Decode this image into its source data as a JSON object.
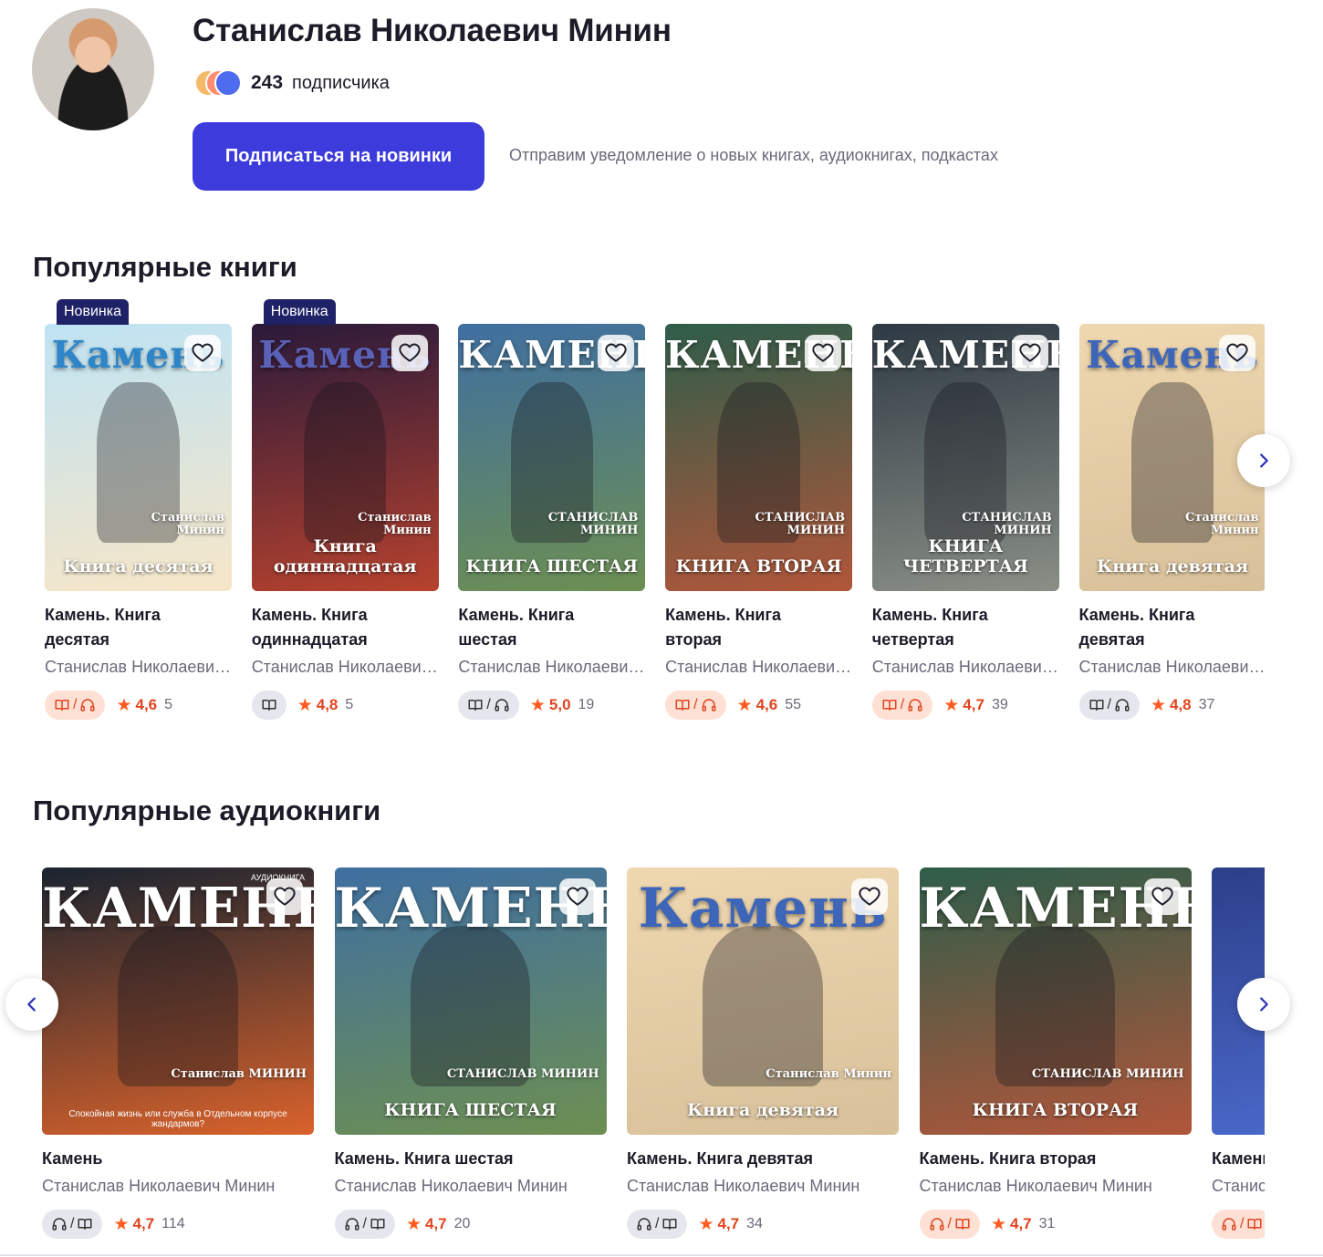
{
  "author": {
    "name": "Станислав Николаевич Минин",
    "subscribers_count": "243",
    "subscribers_label": "подписчика",
    "subscribe_button": "Подписаться на новинки",
    "subscribe_note": "Отправим уведомление о новых книгах, аудиокнигах, подкастах"
  },
  "books_section": {
    "title": "Популярные книги",
    "badge_label": "Новинка",
    "items": [
      {
        "title": "Камень. Книга десятая",
        "author": "Станислав Николаевич Минин",
        "new": true,
        "formats": "book/audio",
        "format_style": "orange",
        "rating": "4,6",
        "votes": "5",
        "cover": {
          "big": "Камень",
          "sub": "Книга десятая",
          "by": "Станислав Минин"
        }
      },
      {
        "title": "Камень. Книга одиннадцатая",
        "author": "Станислав Николаевич Минин",
        "new": true,
        "formats": "book",
        "format_style": "grey",
        "rating": "4,8",
        "votes": "5",
        "cover": {
          "big": "Камень",
          "sub": "Книга одиннадцатая",
          "by": "Станислав Минин"
        }
      },
      {
        "title": "Камень. Книга шестая",
        "author": "Станислав Николаевич Минин",
        "new": false,
        "formats": "book/audio",
        "format_style": "grey",
        "rating": "5,0",
        "votes": "19",
        "cover": {
          "big": "КАМЕНЬ",
          "sub": "КНИГА ШЕСТАЯ",
          "by": "СТАНИСЛАВ МИНИН"
        }
      },
      {
        "title": "Камень. Книга вторая",
        "author": "Станислав Николаевич Минин",
        "new": false,
        "formats": "book/audio",
        "format_style": "orange",
        "rating": "4,6",
        "votes": "55",
        "cover": {
          "big": "КАМЕНЬ",
          "sub": "КНИГА ВТОРАЯ",
          "by": "СТАНИСЛАВ МИНИН"
        }
      },
      {
        "title": "Камень. Книга четвертая",
        "author": "Станислав Николаевич Минин",
        "new": false,
        "formats": "book/audio",
        "format_style": "orange",
        "rating": "4,7",
        "votes": "39",
        "cover": {
          "big": "КАМЕНЬ",
          "sub": "КНИГА ЧЕТВЕРТАЯ",
          "by": "СТАНИСЛАВ МИНИН"
        }
      },
      {
        "title": "Камень. Книга девятая",
        "author": "Станислав Николаевич Минин",
        "new": false,
        "formats": "book/audio",
        "format_style": "grey",
        "rating": "4,8",
        "votes": "37",
        "cover": {
          "big": "Камень",
          "sub": "Книга девятая",
          "by": "Станислав Минин"
        }
      }
    ]
  },
  "audio_section": {
    "title": "Популярные аудиокниги",
    "items": [
      {
        "title": "Камень",
        "author": "Станислав Николаевич Минин",
        "formats": "audio/book",
        "format_style": "grey",
        "rating": "4,7",
        "votes": "114",
        "cover": {
          "big": "КАМЕНЬ",
          "by": "Станислав МИНИН",
          "tag": "АУДИОКНИГА",
          "tagline": "Спокойная жизнь или служба в Отдельном корпусе жандармов?"
        }
      },
      {
        "title": "Камень. Книга шестая",
        "author": "Станислав Николаевич Минин",
        "formats": "audio/book",
        "format_style": "grey",
        "rating": "4,7",
        "votes": "20",
        "cover": {
          "big": "КАМЕНЬ",
          "sub": "КНИГА ШЕСТАЯ",
          "by": "СТАНИСЛАВ МИНИН"
        }
      },
      {
        "title": "Камень. Книга девятая",
        "author": "Станислав Николаевич Минин",
        "formats": "audio/book",
        "format_style": "grey",
        "rating": "4,7",
        "votes": "34",
        "cover": {
          "big": "Камень",
          "sub": "Книга девятая",
          "by": "Станислав Минин"
        }
      },
      {
        "title": "Камень. Книга вторая",
        "author": "Станислав Николаевич Минин",
        "formats": "audio/book",
        "format_style": "orange",
        "rating": "4,7",
        "votes": "31",
        "cover": {
          "big": "КАМЕНЬ",
          "sub": "КНИГА ВТОРАЯ",
          "by": "СТАНИСЛАВ МИНИН"
        }
      },
      {
        "title": "Камень",
        "author": "Станислав",
        "formats": "audio/book",
        "format_style": "orange",
        "rating": "",
        "votes": "",
        "cover": {
          "big": "",
          "sub": "",
          "by": ""
        }
      }
    ]
  },
  "colors": {
    "accent": "#3d3bdb",
    "badge": "#1f2266",
    "rating": "#ff5a1f"
  },
  "icons": {
    "favorite": "heart-outline-icon",
    "next": "chevron-right-icon",
    "prev": "chevron-left-icon",
    "book": "open-book-icon",
    "audio": "headphones-icon",
    "star": "star-icon"
  }
}
